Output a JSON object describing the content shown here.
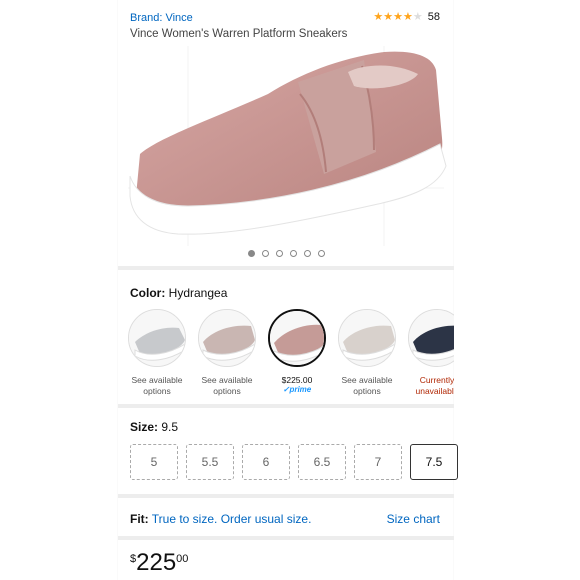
{
  "header": {
    "brand": "Brand: Vince",
    "rating": {
      "stars": 4,
      "max": 5,
      "count": "58"
    },
    "title": "Vince Women's Warren Platform Sneakers"
  },
  "gallery": {
    "total_images": 6,
    "active_index": 0
  },
  "color": {
    "label": "Color:",
    "value": "Hydrangea",
    "swatches": [
      {
        "text_line1": "See available",
        "text_line2": "options",
        "tone": "#c7c9cc"
      },
      {
        "text_line1": "See available",
        "text_line2": "options",
        "tone": "#c9b6b2"
      },
      {
        "price": "$225.00",
        "prime": "✓prime",
        "tone": "#c59b97",
        "selected": true
      },
      {
        "text_line1": "See available",
        "text_line2": "options",
        "tone": "#d8d1cc"
      },
      {
        "unavail_line1": "Currently",
        "unavail_line2": "unavailable",
        "tone": "#2c3446"
      }
    ]
  },
  "size": {
    "label": "Size:",
    "value": "9.5",
    "options": [
      "5",
      "5.5",
      "6",
      "6.5",
      "7",
      "7.5"
    ],
    "selected": "7.5"
  },
  "fit": {
    "label": "Fit:",
    "text": "True to size. Order usual size.",
    "size_chart": "Size chart"
  },
  "price": {
    "currency": "$",
    "whole": "225",
    "fraction": "00"
  },
  "colors": {
    "link": "#0066c0",
    "star": "#ffa41c",
    "unavailable": "#b12704",
    "prime": "#1a98ff"
  }
}
